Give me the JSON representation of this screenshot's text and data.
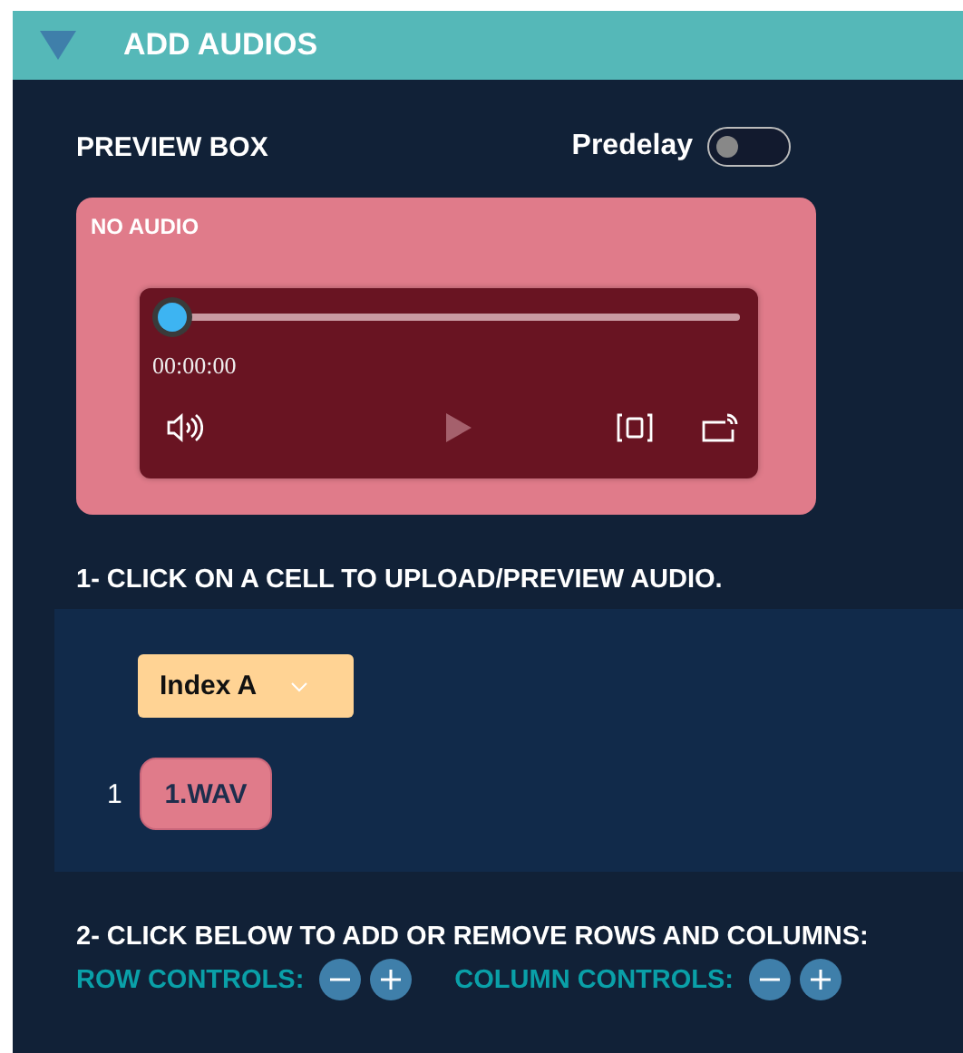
{
  "section": {
    "title": "ADD AUDIOS",
    "expanded": true
  },
  "preview": {
    "title": "PREVIEW BOX",
    "predelay": {
      "label": "Predelay",
      "on": false
    },
    "status": "NO AUDIO",
    "player": {
      "time": "00:00:00",
      "level": 0
    }
  },
  "step1": "1- CLICK ON A CELL TO UPLOAD/PREVIEW AUDIO.",
  "grid": {
    "columns": [
      {
        "label": "Index A"
      }
    ],
    "rows": [
      {
        "label": "1",
        "cells": [
          "1.WAV"
        ]
      }
    ]
  },
  "step2": "2- CLICK BELOW TO ADD OR REMOVE ROWS AND COLUMNS:",
  "controls": [
    {
      "label": "ROW CONTROLS:"
    },
    {
      "label": "COLUMN CONTROLS:"
    }
  ]
}
